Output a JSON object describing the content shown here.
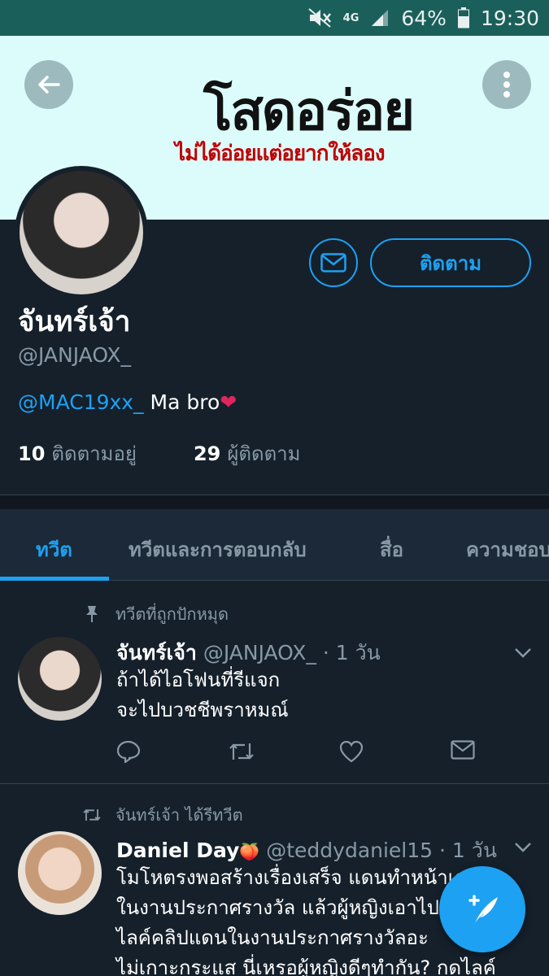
{
  "status_bar": {
    "network": "4G",
    "battery": "64%",
    "time": "19:30"
  },
  "banner": {
    "title": "โสดอร่อย",
    "subtitle": "ไม่ได้อ่อยแต่อยากให้ลอง"
  },
  "profile": {
    "follow_label": "ติดตาม",
    "display_name": "จันทร์เจ้า",
    "handle": "@JANJAOX_",
    "bio_mention": "@MAC19xx_",
    "bio_text": " Ma bro",
    "bio_emoji": "❤",
    "following_count": "10",
    "following_label": "ติดตามอยู่",
    "followers_count": "29",
    "followers_label": "ผู้ติดตาม"
  },
  "tabs": [
    {
      "label": "ทวีต",
      "active": true
    },
    {
      "label": "ทวีตและการตอบกลับ",
      "active": false
    },
    {
      "label": "สื่อ",
      "active": false
    },
    {
      "label": "ความชอบ",
      "active": false
    }
  ],
  "tweets": [
    {
      "context": "ทวีตที่ถูกปักหมุด",
      "context_icon": "pin-icon",
      "name": "จันทร์เจ้า",
      "handle": "@JANJAOX_",
      "time": "· 1 วัน",
      "lines": [
        "ถ้าได้ไอโฟนที่รีแจก",
        "จะไปบวชชีพราหมณ์"
      ]
    },
    {
      "context": "จันทร์เจ้า ได้รีทวีต",
      "context_icon": "retweet-icon",
      "name": "Daniel Day",
      "name_emoji": "🍑",
      "handle": "@teddydaniel15",
      "time": "· 1 วัน",
      "lines": [
        "โมโหตรงพอสร้างเรื่องเสร็จ แดนทำหน้าเศร้า",
        "ในงานประกาศรางวัล แล้วผู้หญิงเอาไป",
        "ไลค์คลิปแดนในงานประกาศรางวัลอะ",
        "ไม่เกาะกระแส นี่เหรอผู้หญิงดีๆทำกัน? กดไลค์"
      ]
    }
  ],
  "colors": {
    "accent": "#1da1f2",
    "background": "#15202b",
    "muted": "#8899a6",
    "status_bar": "#1b5f5a",
    "banner": "#dcfbfb"
  }
}
